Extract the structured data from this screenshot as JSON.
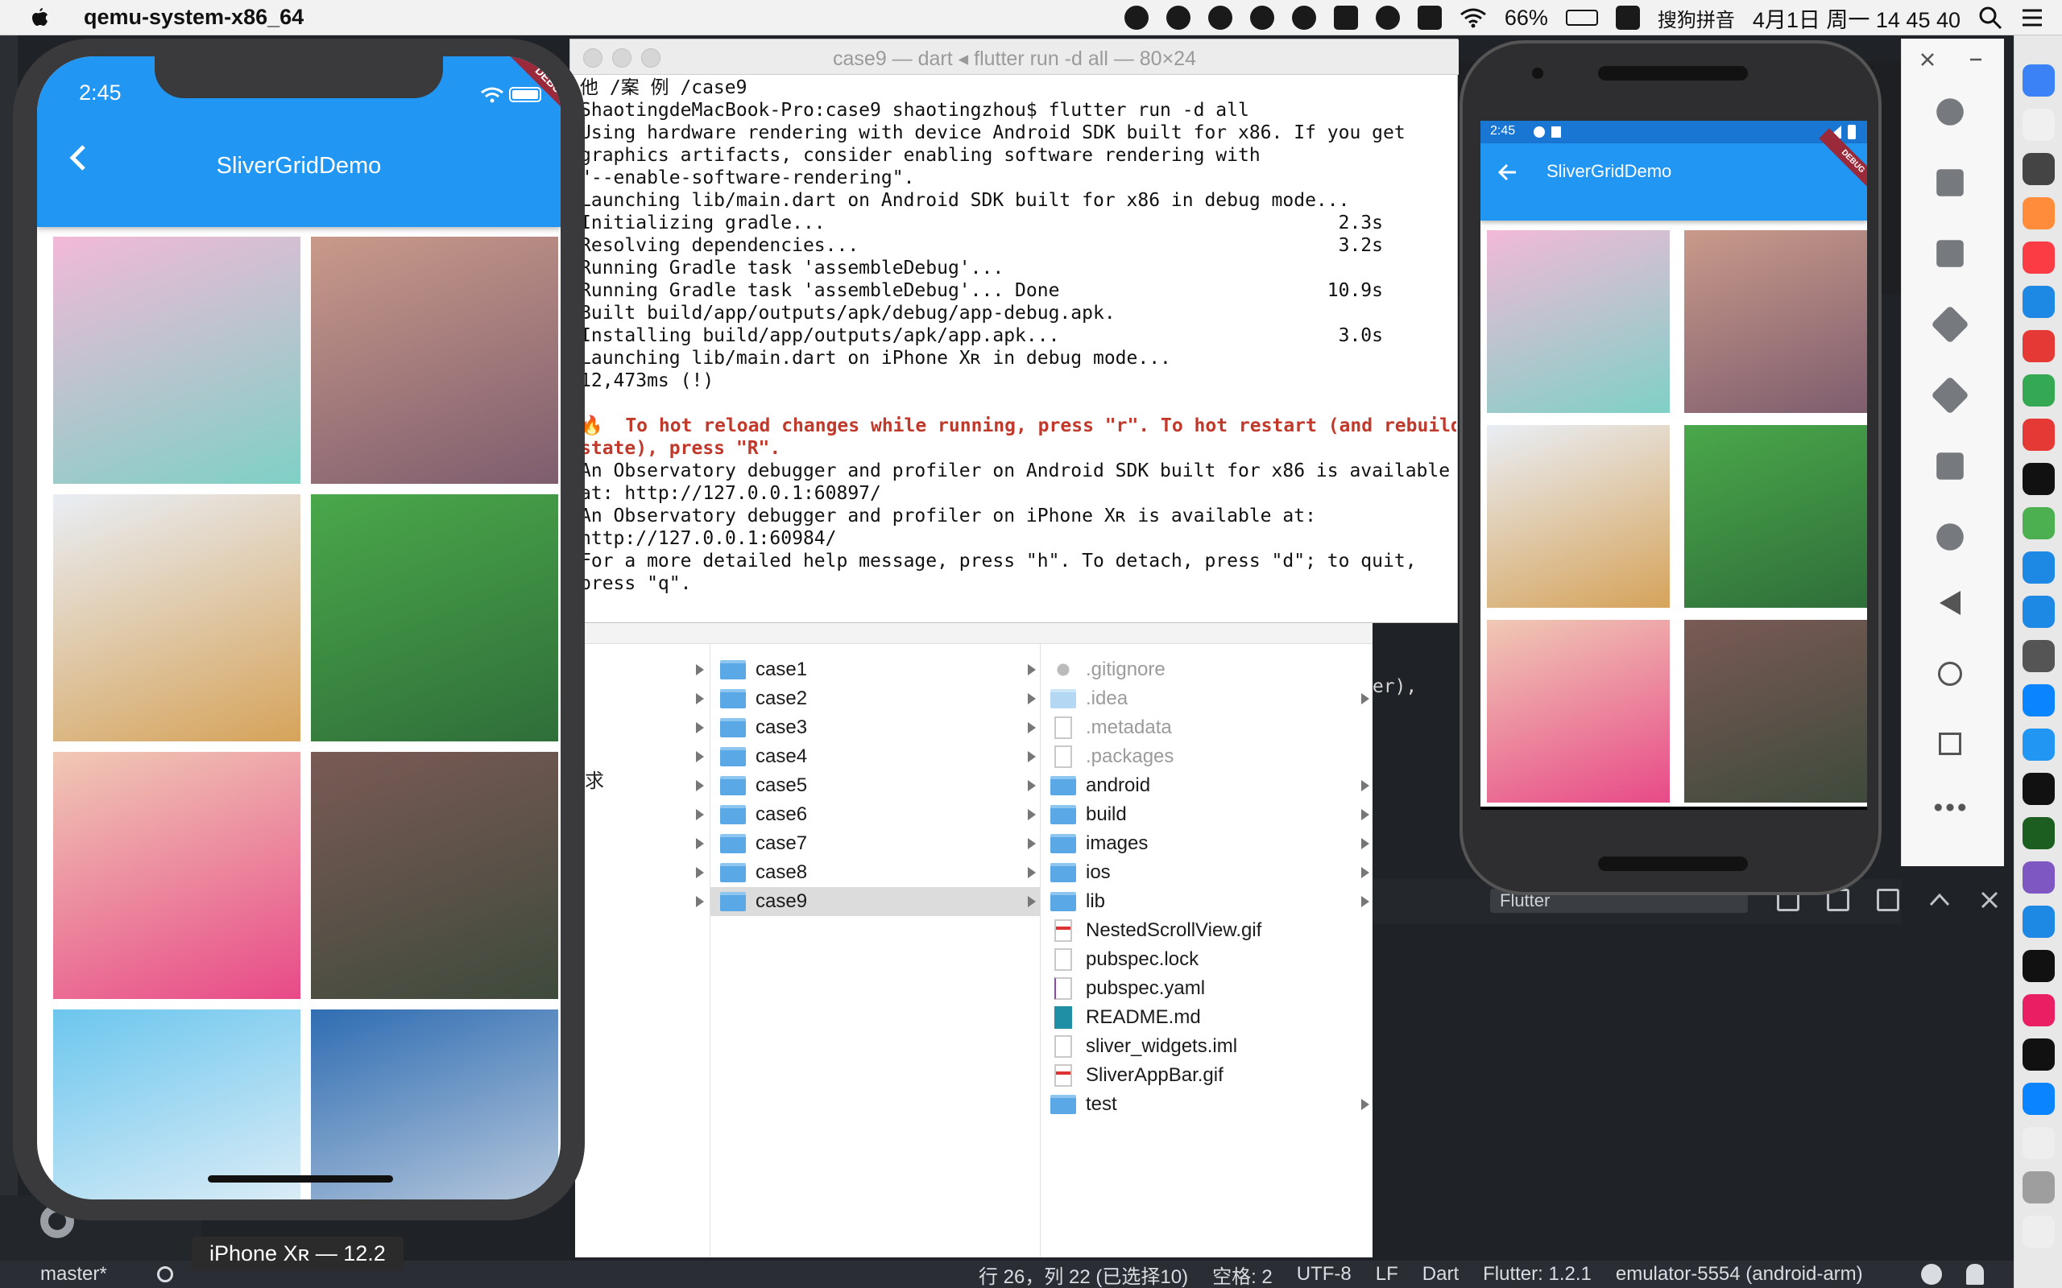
{
  "menubar": {
    "app_name": "qemu-system-x86_64",
    "battery": "66%",
    "input_method": "搜狗拼音",
    "clock": "4月1日 周一  14 45 40",
    "icons": [
      "apple-icon",
      "bird-icon",
      "search-circle-icon",
      "wechat-icon",
      "qq-icon",
      "app-badge-icon",
      "screen-icon",
      "smiley-icon",
      "ying-icon",
      "wifi-icon",
      "battery-icon",
      "sogou-icon",
      "spotlight-icon",
      "control-center-icon"
    ]
  },
  "terminal": {
    "title": "case9 — dart ◂ flutter run -d all — 80×24",
    "lines": [
      "他 /案 例 /case9",
      "ShaotingdeMacBook-Pro:case9 shaotingzhou$ flutter run -d all",
      "Using hardware rendering with device Android SDK built for x86. If you get",
      "graphics artifacts, consider enabling software rendering with",
      "\"--enable-software-rendering\".",
      "Launching lib/main.dart on Android SDK built for x86 in debug mode...",
      "Initializing gradle...                                              2.3s",
      "Resolving dependencies...                                           3.2s",
      "Running Gradle task 'assembleDebug'...",
      "Running Gradle task 'assembleDebug'... Done                        10.9s",
      "Built build/app/outputs/apk/debug/app-debug.apk.",
      "Installing build/app/outputs/apk/app.apk...                         3.0s",
      "Launching lib/main.dart on iPhone Xʀ in debug mode...",
      "12,473ms (!)",
      "",
      "🔥  To hot reload changes while running, press \"r\". To hot restart (and rebuild",
      "state), press \"R\".",
      "An Observatory debugger and profiler on Android SDK built for x86 is available",
      "at: http://127.0.0.1:60897/",
      "An Observatory debugger and profiler on iPhone Xʀ is available at:",
      "http://127.0.0.1:60984/",
      "For a more detailed help message, press \"h\". To detach, press \"d\"; to quit,",
      "press \"q\"."
    ]
  },
  "iphone": {
    "time": "2:45",
    "title": "SliverGridDemo",
    "debug_banner": "DEBUG",
    "label": "iPhone Xʀ — 12.2",
    "tiles": [
      {
        "name": "candy-shop-image",
        "c1": "#f2b9d7",
        "c2": "#7fd0c6"
      },
      {
        "name": "game-console-image",
        "c1": "#c99a8a",
        "c2": "#7e5d6e"
      },
      {
        "name": "glass-dome-image",
        "c1": "#e9eef5",
        "c2": "#d6a35a"
      },
      {
        "name": "dragon-castle-image",
        "c1": "#4aa84a",
        "c2": "#2f6e3a"
      },
      {
        "name": "cactus-image",
        "c1": "#f0c9b5",
        "c2": "#e84a88"
      },
      {
        "name": "water-tower-image",
        "c1": "#7a5a55",
        "c2": "#3e4a3c"
      },
      {
        "name": "ice-cream-truck-image",
        "c1": "#6cc6ee",
        "c2": "#f0f4f8"
      },
      {
        "name": "room-desk-image",
        "c1": "#2f6db2",
        "c2": "#cfd8e4"
      }
    ]
  },
  "android": {
    "time": "2:45",
    "title": "SliverGridDemo",
    "debug_banner": "DEBUG",
    "tiles": [
      {
        "name": "candy-shop-image",
        "c1": "#f2b9d7",
        "c2": "#7fd0c6"
      },
      {
        "name": "game-console-image",
        "c1": "#c99a8a",
        "c2": "#7e5d6e"
      },
      {
        "name": "glass-dome-image",
        "c1": "#e9eef5",
        "c2": "#d6a35a"
      },
      {
        "name": "dragon-castle-image",
        "c1": "#4aa84a",
        "c2": "#2f6e3a"
      },
      {
        "name": "cactus-image",
        "c1": "#f0c9b5",
        "c2": "#e84a88"
      },
      {
        "name": "water-tower-image",
        "c1": "#7a5a55",
        "c2": "#3e4a3c"
      }
    ]
  },
  "finder": {
    "col1": [
      "case1",
      "case2",
      "case3",
      "case4",
      "case5",
      "case6",
      "case7",
      "case8",
      "case9"
    ],
    "col1_selected": "case9",
    "col2": [
      {
        "label": ".gitignore",
        "kind": "gear",
        "dim": true
      },
      {
        "label": ".idea",
        "kind": "folder",
        "dim": true,
        "arrow": true
      },
      {
        "label": ".metadata",
        "kind": "doc",
        "dim": true
      },
      {
        "label": ".packages",
        "kind": "doc",
        "dim": true
      },
      {
        "label": "android",
        "kind": "folder",
        "arrow": true
      },
      {
        "label": "build",
        "kind": "folder",
        "arrow": true
      },
      {
        "label": "images",
        "kind": "folder",
        "arrow": true
      },
      {
        "label": "ios",
        "kind": "folder",
        "arrow": true
      },
      {
        "label": "lib",
        "kind": "folder",
        "arrow": true
      },
      {
        "label": "NestedScrollView.gif",
        "kind": "image"
      },
      {
        "label": "pubspec.lock",
        "kind": "doc"
      },
      {
        "label": "pubspec.yaml",
        "kind": "yaml"
      },
      {
        "label": "README.md",
        "kind": "md"
      },
      {
        "label": "sliver_widgets.iml",
        "kind": "doc"
      },
      {
        "label": "SliverAppBar.gif",
        "kind": "image"
      },
      {
        "label": "test",
        "kind": "folder",
        "arrow": true
      }
    ],
    "side_text": "求"
  },
  "ide": {
    "snippet": "ver),",
    "flutter_select": "Flutter",
    "status": {
      "branch": "master*",
      "position": "行 26，列 22 (已选择10)",
      "spaces": "空格: 2",
      "encoding": "UTF-8",
      "eol": "LF",
      "language": "Dart",
      "flutter": "Flutter: 1.2.1",
      "device": "emulator-5554 (android-arm)"
    }
  },
  "emulator_tools": [
    "power-icon",
    "volume-up-icon",
    "volume-down-icon",
    "rotate-left-icon",
    "rotate-right-icon",
    "camera-icon",
    "zoom-icon",
    "back-icon",
    "home-icon",
    "overview-icon",
    "more-icon"
  ],
  "dock_colors": [
    "#3b82f6",
    "#f0f0f0",
    "#444",
    "#ff8c3a",
    "#fc3c44",
    "#1e88e5",
    "#e53935",
    "#34a853",
    "#e53935",
    "#111",
    "#4caf50",
    "#1e88e5",
    "#1e88e5",
    "#555",
    "#0a84ff",
    "#2196f3",
    "#111",
    "#1b5e20",
    "#7e57c2",
    "#1e88e5",
    "#111",
    "#e91e63",
    "#111",
    "#0a84ff",
    "#eee",
    "#9e9e9e",
    "#eee"
  ]
}
